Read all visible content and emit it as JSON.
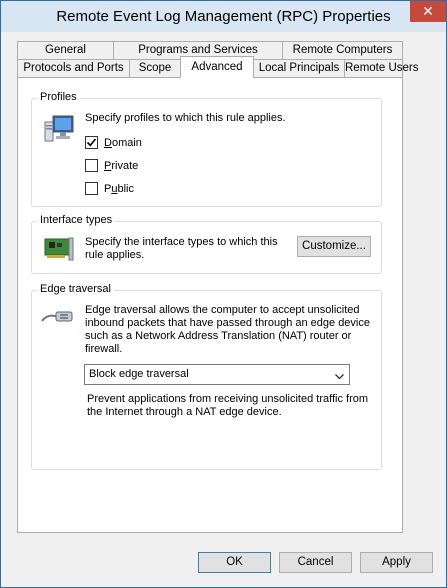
{
  "window": {
    "title": "Remote Event Log Management (RPC) Properties",
    "close_label": "✕"
  },
  "tabs": {
    "row1": [
      {
        "label": "General"
      },
      {
        "label": "Programs and Services"
      },
      {
        "label": "Remote Computers"
      }
    ],
    "row2": [
      {
        "label": "Protocols and Ports"
      },
      {
        "label": "Scope"
      },
      {
        "label": "Advanced"
      },
      {
        "label": "Local Principals"
      },
      {
        "label": "Remote Users"
      }
    ],
    "active": "Advanced"
  },
  "profiles": {
    "title": "Profiles",
    "description": "Specify profiles to which this rule applies.",
    "icon": "computer-icon",
    "items": [
      {
        "label": "Domain",
        "checked": true
      },
      {
        "label": "Private",
        "checked": false
      },
      {
        "label": "Public",
        "checked": false
      }
    ]
  },
  "interface_types": {
    "title": "Interface types",
    "description_line1": "Specify the interface types to which this",
    "description_line2": "rule applies.",
    "icon": "network-card-icon",
    "customize_label": "Customize..."
  },
  "edge_traversal": {
    "title": "Edge traversal",
    "icon": "network-cable-icon",
    "description_lines": [
      "Edge traversal allows the computer to accept unsolicited",
      "inbound packets that have passed through an edge device",
      "such as a Network Address Translation (NAT) router or",
      "firewall."
    ],
    "selected_option": "Block edge traversal",
    "option_description_lines": [
      "Prevent applications from receiving unsolicited traffic from",
      "the Internet through a NAT edge device."
    ]
  },
  "buttons": {
    "ok": "OK",
    "cancel": "Cancel",
    "apply": "Apply"
  },
  "colors": {
    "titlebar": "#d8e5f2",
    "close_button": "#c7493a",
    "panel": "#ffffff",
    "dialog": "#f0f0f0"
  }
}
